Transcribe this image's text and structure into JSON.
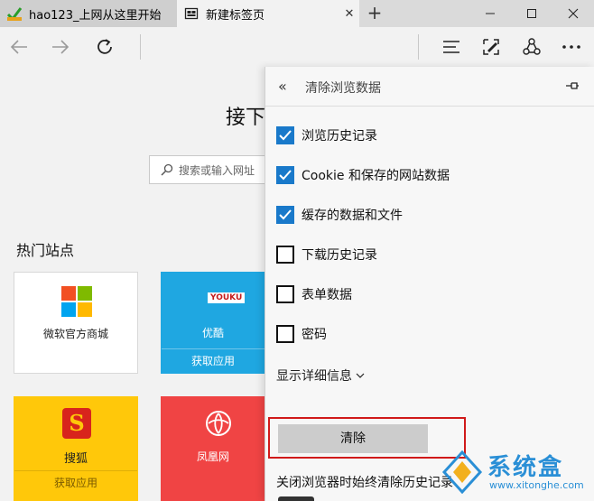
{
  "tabs": [
    {
      "title": "hao123_上网从这里开始",
      "icon": "hao123-icon"
    },
    {
      "title": "新建标签页",
      "icon": "newtab-page-icon"
    }
  ],
  "content": {
    "heading_partial": "接下",
    "search_placeholder": "搜索或输入网址",
    "section_title": "热门站点",
    "sites": [
      {
        "name": "微软官方商城",
        "sub": "",
        "color": "#ffffff"
      },
      {
        "name": "优酷",
        "sub": "获取应用",
        "color": "#1fa7e1",
        "logo": "YOUKU"
      },
      {
        "name": "搜狐",
        "sub": "获取应用",
        "color": "#ffc80a",
        "logo": "S"
      },
      {
        "name": "凤凰网",
        "sub": "",
        "color": "#f04444"
      }
    ]
  },
  "panel": {
    "title": "清除浏览数据",
    "options": [
      {
        "label": "浏览历史记录",
        "checked": true
      },
      {
        "label": "Cookie 和保存的网站数据",
        "checked": true
      },
      {
        "label": "缓存的数据和文件",
        "checked": true
      },
      {
        "label": "下载历史记录",
        "checked": false
      },
      {
        "label": "表单数据",
        "checked": false
      },
      {
        "label": "密码",
        "checked": false
      }
    ],
    "details_label": "显示详细信息",
    "clear_label": "清除",
    "always_clear_label": "关闭浏览器时始终清除历史记录"
  },
  "watermark": {
    "name": "系统盒",
    "url": "www.xitonghe.com"
  },
  "colors": {
    "accent": "#1979ca",
    "highlight": "#d01a1a"
  }
}
